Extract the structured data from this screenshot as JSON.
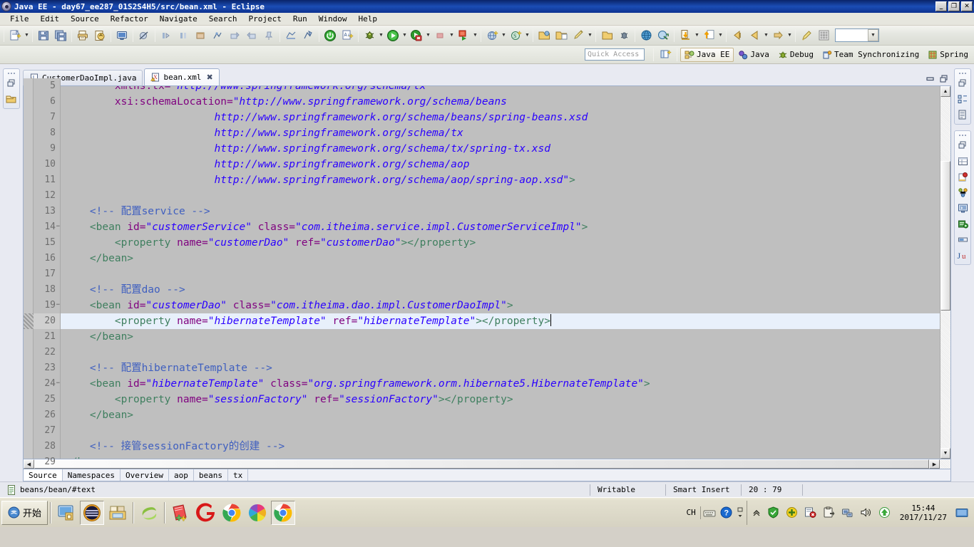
{
  "window": {
    "title": "Java EE - day67_ee287_01S2S4H5/src/bean.xml - Eclipse",
    "minimize": "_",
    "maximize": "❐",
    "close": "✕"
  },
  "menubar": {
    "items": [
      "File",
      "Edit",
      "Source",
      "Refactor",
      "Navigate",
      "Search",
      "Project",
      "Run",
      "Window",
      "Help"
    ]
  },
  "toolbar": {
    "groups": [
      {
        "items": [
          {
            "name": "new-wizard-icon",
            "arrow": true
          },
          {
            "name": "save-icon",
            "arrow": false
          },
          {
            "name": "save-all-icon",
            "arrow": false
          }
        ]
      },
      {
        "items": [
          {
            "name": "print-icon",
            "arrow": false
          },
          {
            "name": "export-icon",
            "arrow": false
          }
        ]
      },
      {
        "items": [
          {
            "name": "console-icon",
            "arrow": false
          }
        ]
      },
      {
        "items": [
          {
            "name": "toggle-breakpoint-icon",
            "arrow": false
          }
        ]
      },
      {
        "items": [
          {
            "name": "next-annotation-icon",
            "arrow": false
          },
          {
            "name": "previous-annotation-icon",
            "arrow": false
          },
          {
            "name": "last-edit-location-icon",
            "arrow": false
          },
          {
            "name": "open-type-icon",
            "arrow": false
          },
          {
            "name": "back-history-icon",
            "arrow": false
          },
          {
            "name": "forward-history-icon",
            "arrow": false
          },
          {
            "name": "pin-editor-icon",
            "arrow": false
          }
        ]
      },
      {
        "items": [
          {
            "name": "server-icon",
            "arrow": false
          },
          {
            "name": "start-server-icon",
            "arrow": false
          }
        ]
      },
      {
        "items": [
          {
            "name": "power-icon",
            "arrow": false
          },
          {
            "name": "validate-icon",
            "arrow": false
          }
        ]
      },
      {
        "items": [
          {
            "name": "debug-icon",
            "arrow": true
          },
          {
            "name": "run-icon",
            "arrow": true
          },
          {
            "name": "coverage-icon",
            "arrow": true
          },
          {
            "name": "stop-icon",
            "arrow": true
          },
          {
            "name": "run-external-tools-icon",
            "arrow": true
          }
        ]
      },
      {
        "items": [
          {
            "name": "new-java-project-icon",
            "arrow": true
          },
          {
            "name": "new-spring-element-icon",
            "arrow": true
          }
        ]
      },
      {
        "items": [
          {
            "name": "open-folder-icon",
            "arrow": false
          },
          {
            "name": "open-resource-icon",
            "arrow": false
          },
          {
            "name": "pencil-icon",
            "arrow": true
          }
        ]
      },
      {
        "items": [
          {
            "name": "package-icon",
            "arrow": false
          },
          {
            "name": "ant-build-icon",
            "arrow": false
          }
        ]
      },
      {
        "items": [
          {
            "name": "globe-icon",
            "arrow": false
          },
          {
            "name": "deploy-icon",
            "arrow": false
          }
        ]
      },
      {
        "items": [
          {
            "name": "download-icon",
            "arrow": true
          },
          {
            "name": "upload-icon",
            "arrow": true
          }
        ]
      },
      {
        "items": [
          {
            "name": "previous-edit-icon",
            "arrow": false
          },
          {
            "name": "back-navigation-icon",
            "arrow": true
          },
          {
            "name": "forward-navigation-icon",
            "arrow": true
          }
        ]
      },
      {
        "items": [
          {
            "name": "highlight-icon",
            "arrow": false
          },
          {
            "name": "grid-icon",
            "arrow": false
          }
        ]
      }
    ],
    "combo_value": ""
  },
  "perspective": {
    "quick_access_placeholder": "Quick Access",
    "open_perspective_icon": "open-perspective-icon",
    "items": [
      {
        "label": "Java EE",
        "icon": "java-ee-perspective-icon",
        "active": true
      },
      {
        "label": "Java",
        "icon": "java-perspective-icon",
        "active": false
      },
      {
        "label": "Debug",
        "icon": "debug-perspective-icon",
        "active": false
      },
      {
        "label": "Team Synchronizing",
        "icon": "team-sync-perspective-icon",
        "active": false
      },
      {
        "label": "Spring",
        "icon": "spring-perspective-icon",
        "active": false
      }
    ]
  },
  "left_rail": {
    "icons": [
      "restore-view-icon",
      "project-explorer-icon"
    ]
  },
  "right_rail": {
    "group1": [
      "restore-view-icon",
      "outline-view-icon",
      "task-list-icon"
    ],
    "group2": [
      "restore-view-icon",
      "properties-view-icon",
      "snippets-view-icon",
      "servers-view-icon",
      "console-view-icon",
      "markers-view-icon",
      "progress-view-icon",
      "junit-view-icon"
    ]
  },
  "editor": {
    "tabs": [
      {
        "label": "CustomerDaoImpl.java",
        "icon": "java-file-icon",
        "active": false,
        "closable": false
      },
      {
        "label": "bean.xml",
        "icon": "xml-file-icon",
        "active": true,
        "closable": true
      }
    ],
    "tab_close_glyph": "✖",
    "view_minimize": "▬",
    "view_maximize": "❐",
    "bottom_tabs": [
      {
        "label": "Source",
        "active": true
      },
      {
        "label": "Namespaces",
        "active": false
      },
      {
        "label": "Overview",
        "active": false
      },
      {
        "label": "aop",
        "active": false
      },
      {
        "label": "beans",
        "active": false
      },
      {
        "label": "tx",
        "active": false
      }
    ],
    "current_line": 20,
    "first_line": 5,
    "lines": [
      {
        "n": 5,
        "fold": false,
        "partial": true,
        "tokens": [
          {
            "t": "        xmlns:tx=",
            "c": "at"
          },
          {
            "t": "\"http://www.springframework.org/schema/tx",
            "c": "st"
          }
        ]
      },
      {
        "n": 6,
        "fold": false,
        "tokens": [
          {
            "t": "        xsi:schemaLocation=",
            "c": "at"
          },
          {
            "t": "\"http://www.springframework.org/schema/beans",
            "c": "st"
          }
        ]
      },
      {
        "n": 7,
        "fold": false,
        "tokens": [
          {
            "t": "                        http://www.springframework.org/schema/beans/spring-beans.xsd",
            "c": "st"
          }
        ]
      },
      {
        "n": 8,
        "fold": false,
        "tokens": [
          {
            "t": "                        http://www.springframework.org/schema/tx",
            "c": "st"
          }
        ]
      },
      {
        "n": 9,
        "fold": false,
        "tokens": [
          {
            "t": "                        http://www.springframework.org/schema/tx/spring-tx.xsd",
            "c": "st"
          }
        ]
      },
      {
        "n": 10,
        "fold": false,
        "tokens": [
          {
            "t": "                        http://www.springframework.org/schema/aop",
            "c": "st"
          }
        ]
      },
      {
        "n": 11,
        "fold": false,
        "tokens": [
          {
            "t": "                        http://www.springframework.org/schema/aop/spring-aop.xsd\"",
            "c": "st"
          },
          {
            "t": ">",
            "c": "k"
          }
        ]
      },
      {
        "n": 12,
        "fold": false,
        "tokens": []
      },
      {
        "n": 13,
        "fold": false,
        "tokens": [
          {
            "t": "    <!-- 配置service -->",
            "c": "cm"
          }
        ]
      },
      {
        "n": 14,
        "fold": true,
        "tokens": [
          {
            "t": "    <bean ",
            "c": "k"
          },
          {
            "t": "id=",
            "c": "at"
          },
          {
            "t": "\"customerService\"",
            "c": "st"
          },
          {
            "t": " class=",
            "c": "at"
          },
          {
            "t": "\"com.itheima.service.impl.CustomerServiceImpl\"",
            "c": "st"
          },
          {
            "t": ">",
            "c": "k"
          }
        ]
      },
      {
        "n": 15,
        "fold": false,
        "tokens": [
          {
            "t": "        <property ",
            "c": "k"
          },
          {
            "t": "name=",
            "c": "at"
          },
          {
            "t": "\"customerDao\"",
            "c": "st"
          },
          {
            "t": " ref=",
            "c": "at"
          },
          {
            "t": "\"customerDao\"",
            "c": "st"
          },
          {
            "t": "></property>",
            "c": "k"
          }
        ]
      },
      {
        "n": 16,
        "fold": false,
        "tokens": [
          {
            "t": "    </bean>",
            "c": "k"
          }
        ]
      },
      {
        "n": 17,
        "fold": false,
        "tokens": []
      },
      {
        "n": 18,
        "fold": false,
        "tokens": [
          {
            "t": "    <!-- 配置dao -->",
            "c": "cm"
          }
        ]
      },
      {
        "n": 19,
        "fold": true,
        "tokens": [
          {
            "t": "    <bean ",
            "c": "k"
          },
          {
            "t": "id=",
            "c": "at"
          },
          {
            "t": "\"customerDao\"",
            "c": "st"
          },
          {
            "t": " class=",
            "c": "at"
          },
          {
            "t": "\"com.itheima.dao.impl.CustomerDaoImpl\"",
            "c": "st"
          },
          {
            "t": ">",
            "c": "k"
          }
        ]
      },
      {
        "n": 20,
        "fold": false,
        "current": true,
        "tokens": [
          {
            "t": "        <property ",
            "c": "k"
          },
          {
            "t": "name=",
            "c": "at"
          },
          {
            "t": "\"hibernateTemplate\"",
            "c": "st"
          },
          {
            "t": " ref=",
            "c": "at"
          },
          {
            "t": "\"hibernateTemplate\"",
            "c": "st"
          },
          {
            "t": "></property>",
            "c": "k"
          }
        ]
      },
      {
        "n": 21,
        "fold": false,
        "tokens": [
          {
            "t": "    </bean>",
            "c": "k"
          }
        ]
      },
      {
        "n": 22,
        "fold": false,
        "tokens": []
      },
      {
        "n": 23,
        "fold": false,
        "tokens": [
          {
            "t": "    <!-- 配置hibernateTemplate -->",
            "c": "cm"
          }
        ]
      },
      {
        "n": 24,
        "fold": true,
        "tokens": [
          {
            "t": "    <bean ",
            "c": "k"
          },
          {
            "t": "id=",
            "c": "at"
          },
          {
            "t": "\"hibernateTemplate\"",
            "c": "st"
          },
          {
            "t": " class=",
            "c": "at"
          },
          {
            "t": "\"org.springframework.orm.hibernate5.HibernateTemplate\"",
            "c": "st"
          },
          {
            "t": ">",
            "c": "k"
          }
        ]
      },
      {
        "n": 25,
        "fold": false,
        "tokens": [
          {
            "t": "        <property ",
            "c": "k"
          },
          {
            "t": "name=",
            "c": "at"
          },
          {
            "t": "\"sessionFactory\"",
            "c": "st"
          },
          {
            "t": " ref=",
            "c": "at"
          },
          {
            "t": "\"sessionFactory\"",
            "c": "st"
          },
          {
            "t": "></property>",
            "c": "k"
          }
        ]
      },
      {
        "n": 26,
        "fold": false,
        "tokens": [
          {
            "t": "    </bean>",
            "c": "k"
          }
        ]
      },
      {
        "n": 27,
        "fold": false,
        "tokens": []
      },
      {
        "n": 28,
        "fold": false,
        "tokens": [
          {
            "t": "    <!-- 接管sessionFactory的创建 -->",
            "c": "cm"
          }
        ]
      },
      {
        "n": 29,
        "fold": false,
        "tokens": [
          {
            "t": "</beans>",
            "c": "k"
          }
        ]
      }
    ]
  },
  "statusbar": {
    "icon": "document-icon",
    "path": "beans/bean/#text",
    "writable": "Writable",
    "insert_mode": "Smart Insert",
    "position": "20 : 79"
  },
  "taskbar": {
    "start_label": "开始",
    "quicklaunch": [
      {
        "name": "show-desktop-icon"
      },
      {
        "name": "media-player-icon",
        "active": true
      },
      {
        "name": "file-explorer-icon"
      }
    ],
    "apps": [
      {
        "name": "eclipse-taskbar-icon",
        "active": false
      },
      {
        "name": "notepad-plus-plus-taskbar-icon",
        "active": false
      },
      {
        "name": "gif-recorder-taskbar-icon",
        "active": false
      },
      {
        "name": "chrome-taskbar-icon",
        "active": false
      },
      {
        "name": "photos-taskbar-icon",
        "active": false
      },
      {
        "name": "chrome-second-taskbar-icon",
        "active": true
      }
    ],
    "tray": {
      "ime_label": "CH",
      "ime_keyboard_icon": "keyboard-icon",
      "ime_help_icon": "help-icon",
      "ime_expand_icon": "ime-expand-icon",
      "show_hidden_icon": "show-hidden-icons-chevron",
      "icons": [
        "shield-icon",
        "update-icon",
        "security-alert-icon",
        "clipboard-icon",
        "network-icon",
        "volume-icon",
        "uploader-icon"
      ],
      "time": "15:44",
      "date": "2017/11/27",
      "show_desktop_icon": "show-desktop-tray-icon"
    }
  }
}
